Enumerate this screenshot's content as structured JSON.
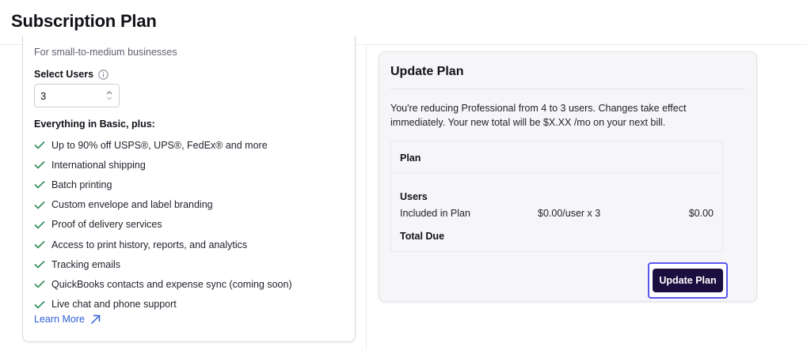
{
  "page": {
    "title": "Subscription Plan"
  },
  "plan_card": {
    "description": "For small-to-medium businesses",
    "select_users_label": "Select Users",
    "users_value": "3",
    "features_title": "Everything in Basic, plus:",
    "features": [
      "Up to 90% off USPS®, UPS®, FedEx® and more",
      "International shipping",
      "Batch printing",
      "Custom envelope and label branding",
      "Proof of delivery services",
      "Access to print history, reports, and analytics",
      "Tracking emails",
      "QuickBooks contacts and expense sync (coming soon)",
      "Live chat and phone support"
    ],
    "learn_more": "Learn More",
    "colors": {
      "check": "#2e8b57",
      "link": "#2d5fd9"
    }
  },
  "update_card": {
    "title": "Update Plan",
    "message": "You're reducing Professional from 4 to 3 users. Changes take effect immediately. Your new total will be $X.XX /mo on your next bill.",
    "summary": {
      "plan_label": "Plan",
      "users_label": "Users",
      "included_label": "Included in Plan",
      "included_rate": "$0.00/user x 3",
      "included_amount": "$0.00",
      "total_label": "Total Due"
    },
    "button_label": "Update Plan",
    "colors": {
      "button": "#1a0f3f",
      "focus_ring": "#5b57f0"
    }
  }
}
